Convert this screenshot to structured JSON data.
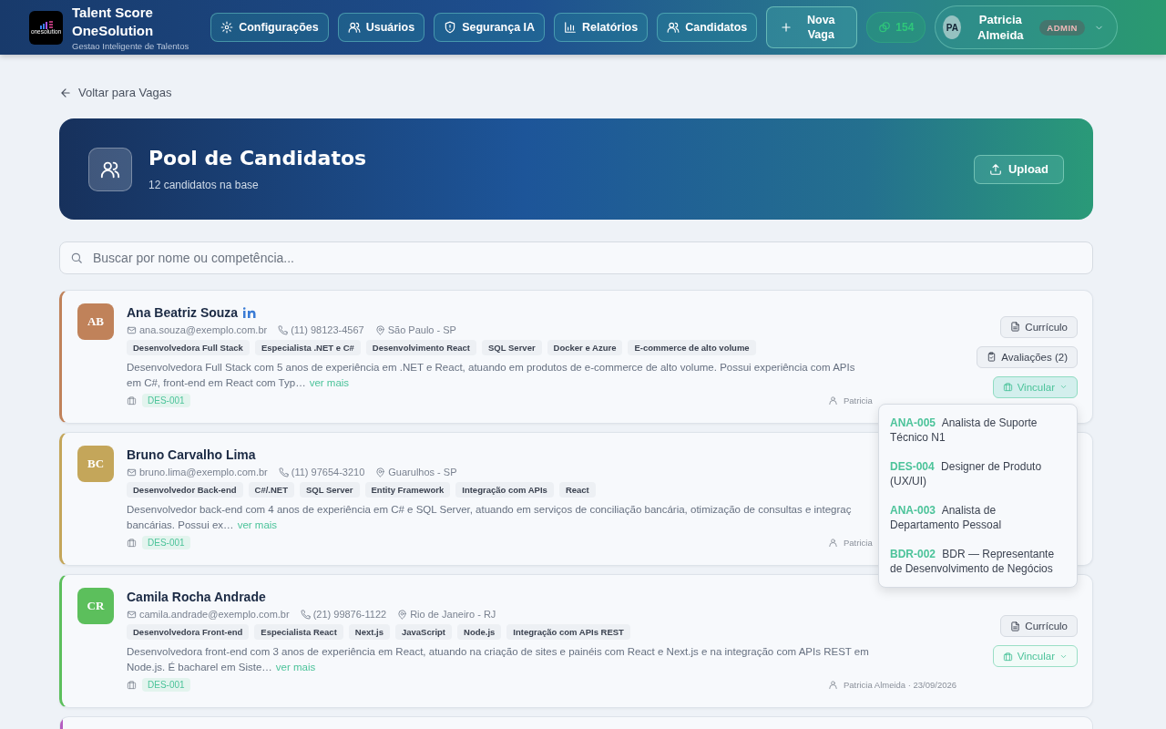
{
  "header": {
    "logo_text": "onesolution",
    "title": "Talent Score OneSolution",
    "subtitle": "Gestao Inteligente de Talentos",
    "nav": [
      {
        "label": "Configurações",
        "kind": "nav"
      },
      {
        "label": "Usuários",
        "kind": "nav"
      },
      {
        "label": "Segurança IA",
        "kind": "nav"
      },
      {
        "label": "Relatórios",
        "kind": "nav"
      },
      {
        "label": "Candidatos",
        "kind": "nav"
      },
      {
        "label": "Nova Vaga",
        "kind": "primary"
      }
    ],
    "credits": "154",
    "user": {
      "initials": "PA",
      "name": "Patricia Almeida",
      "role": "ADMIN"
    }
  },
  "back_link": "Voltar para Vagas",
  "hero": {
    "title": "Pool de Candidatos",
    "subtitle": "12 candidatos na base",
    "button": "Upload"
  },
  "search": {
    "placeholder": "Buscar por nome ou competência..."
  },
  "candidates": [
    {
      "initials": "AB",
      "name": "Ana Beatriz Souza",
      "color": "#c0825a",
      "linkedin": true,
      "email": "ana.souza@exemplo.com.br",
      "phone": "(11) 98123-4567",
      "location": "São Paulo - SP",
      "tags": [
        "Desenvolvedora Full Stack",
        "Especialista .NET e C#",
        "Desenvolvimento React",
        "SQL Server",
        "Docker e Azure",
        "E-commerce de alto volume"
      ],
      "description": "Desenvolvedora Full Stack com 5 anos de experiência em .NET e React, atuando em produtos de e-commerce de alto volume. Possui experiência com APIs em C#, front-end em React com Typ…",
      "more": "ver mais",
      "job": "DES-001",
      "meta": "Patricia",
      "actions": [
        {
          "label": "Currículo",
          "kind": "resume"
        },
        {
          "label": "Avaliações (2)",
          "kind": "reviews"
        },
        {
          "label": "Vincular",
          "kind": "link",
          "expanded": true
        }
      ]
    },
    {
      "initials": "BC",
      "name": "Bruno Carvalho Lima",
      "color": "#c4a65a",
      "linkedin": false,
      "email": "bruno.lima@exemplo.com.br",
      "phone": "(11) 97654-3210",
      "location": "Guarulhos - SP",
      "tags": [
        "Desenvolvedor Back-end",
        "C#/.NET",
        "SQL Server",
        "Entity Framework",
        "Integração com APIs",
        "React"
      ],
      "description": "Desenvolvedor back-end com 4 anos de experiência em C# e SQL Server, atuando em serviços de conciliação bancária, otimização de consultas e integraç bancárias. Possui ex…",
      "more": "ver mais",
      "job": "DES-001",
      "meta": "Patricia"
    },
    {
      "initials": "CR",
      "name": "Camila Rocha Andrade",
      "color": "#5cbf5c",
      "linkedin": false,
      "email": "camila.andrade@exemplo.com.br",
      "phone": "(21) 99876-1122",
      "location": "Rio de Janeiro - RJ",
      "tags": [
        "Desenvolvedora Front-end",
        "Especialista React",
        "Next.js",
        "JavaScript",
        "Node.js",
        "Integração com APIs REST"
      ],
      "description": "Desenvolvedora front-end com 3 anos de experiência em React, atuando na criação de sites e painéis com React e Next.js e na integração com APIs REST em Node.js. É bacharel em Siste…",
      "more": "ver mais",
      "job": "DES-001",
      "meta": "Patricia Almeida · 23/09/2026",
      "actions": [
        {
          "label": "Currículo",
          "kind": "resume"
        },
        {
          "label": "Vincular",
          "kind": "link",
          "expanded": false
        }
      ]
    },
    {
      "color": "#b45cc0",
      "kind": "partial"
    }
  ],
  "link_menu": [
    {
      "code": "ANA-005",
      "title": "Analista de Suporte Técnico N1"
    },
    {
      "code": "DES-004",
      "title": "Designer de Produto (UX/UI)"
    },
    {
      "code": "ANA-003",
      "title": "Analista de Departamento Pessoal"
    },
    {
      "code": "BDR-002",
      "title": "BDR — Representante de Desenvolvimento de Negócios"
    }
  ]
}
